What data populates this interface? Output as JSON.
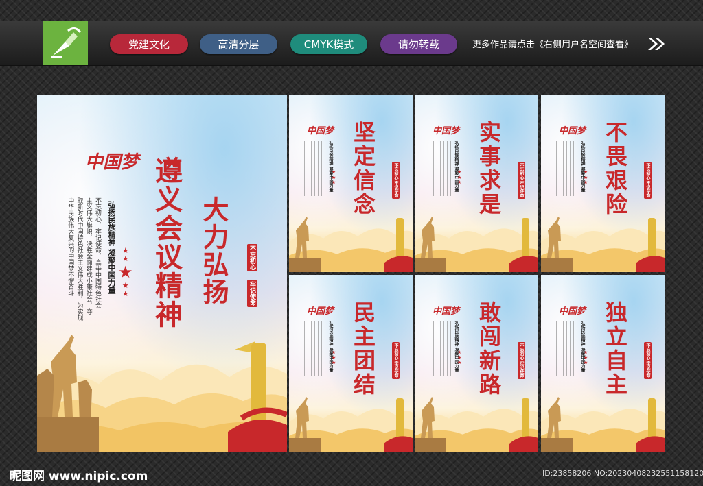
{
  "tags": [
    "党建文化",
    "高清分层",
    "CMYK模式",
    "请勿转载"
  ],
  "tag_colors": [
    "#b8283a",
    "#3f5f86",
    "#1f8c7c",
    "#6b3a8c"
  ],
  "notice": "更多作品请点击《右侧用户名空间查看》",
  "main_poster": {
    "logo_text": "中国梦",
    "title": "遵义会议精神",
    "subtitle": "大力弘扬",
    "slogan_bold": "弘扬民族精神 凝聚中国力量",
    "body": [
      "不忘初心，牢记使命，高举中国特色社会",
      "主义伟大旗帜，决胜全面建成小康社会，夺",
      "取新时代中国特色社会主义伟大胜利，为实现",
      "中华民族伟大复兴的中国梦不懈奋斗"
    ],
    "seal_1": "不忘初心",
    "seal_2": "牢记使命"
  },
  "small_posters": [
    {
      "title": "坚定信念"
    },
    {
      "title": "实事求是"
    },
    {
      "title": "不畏艰险"
    },
    {
      "title": "民主团结"
    },
    {
      "title": "敢闯新路"
    },
    {
      "title": "独立自主"
    }
  ],
  "small_common": {
    "logo_text": "中国梦",
    "slogan_bold": "弘扬民族精神 凝聚中国力量",
    "seal": "不忘初心 牢记使命"
  },
  "footer_site": "昵图网 www.nipic.com",
  "footer_id": "ID:23858206 NO:20230408232551158120"
}
